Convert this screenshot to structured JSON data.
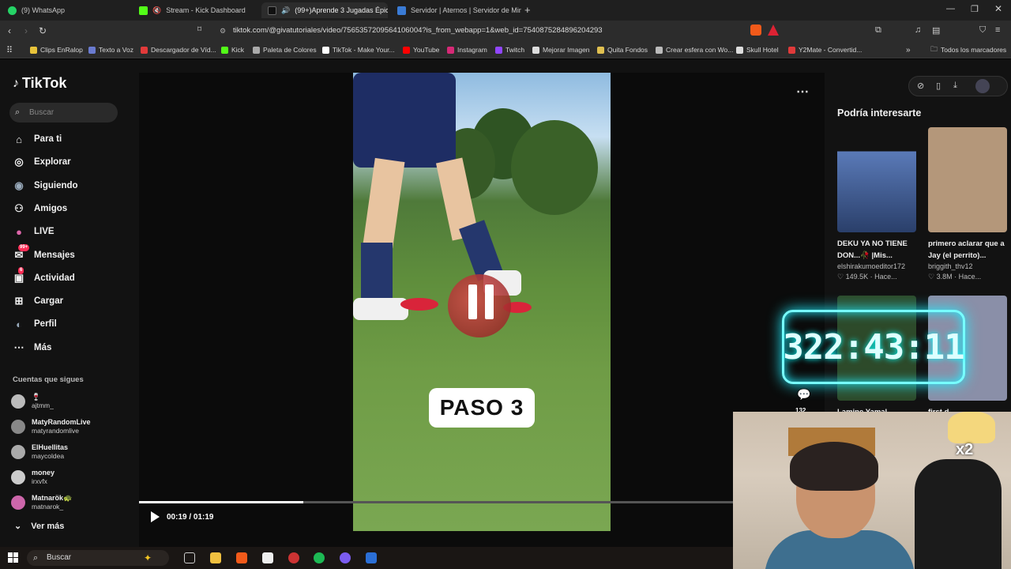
{
  "browser": {
    "tabs": [
      {
        "label": "(9) WhatsApp",
        "color": "#25d366"
      },
      {
        "label": "Stream - Kick Dashboard",
        "color": "#53fc18"
      },
      {
        "label": "(99+)Aprende 3 Jugadas Épic",
        "color": "#ffffff"
      },
      {
        "label": "Servidor | Aternos | Servidor de Mine",
        "color": "#3a7bd5"
      }
    ],
    "url": "tiktok.com/@givatutoriales/video/7565357209564106004?is_from_webapp=1&web_id=7540875284896204293",
    "bookmarks": [
      {
        "label": "Clips EnRalop",
        "color": "#e8c33a"
      },
      {
        "label": "Texto a Voz",
        "color": "#6a7bd0"
      },
      {
        "label": "Descargador de Víd...",
        "color": "#e23a3a"
      },
      {
        "label": "Kick",
        "color": "#53fc18"
      },
      {
        "label": "Paleta de Colores",
        "color": "#aaaaaa"
      },
      {
        "label": "TikTok - Make Your...",
        "color": "#ffffff"
      },
      {
        "label": "YouTube",
        "color": "#ff0000"
      },
      {
        "label": "Instagram",
        "color": "#d62976"
      },
      {
        "label": "Twitch",
        "color": "#9146ff"
      },
      {
        "label": "Mejorar Imagen",
        "color": "#dddddd"
      },
      {
        "label": "Quita Fondos",
        "color": "#e0c050"
      },
      {
        "label": "Crear esfera con Wo...",
        "color": "#bbbbbb"
      },
      {
        "label": "Skull Hotel",
        "color": "#dddddd"
      },
      {
        "label": "Y2Mate - Convertid...",
        "color": "#e03a3a"
      }
    ],
    "bookmarks_all": "Todos los marcadores"
  },
  "tiktok": {
    "logo": "TikTok",
    "search_placeholder": "Buscar",
    "nav": [
      {
        "label": "Para ti",
        "icon": "home-icon"
      },
      {
        "label": "Explorar",
        "icon": "compass-icon"
      },
      {
        "label": "Siguiendo",
        "icon": "following-icon"
      },
      {
        "label": "Amigos",
        "icon": "friends-icon"
      },
      {
        "label": "LIVE",
        "icon": "live-icon"
      },
      {
        "label": "Mensajes",
        "icon": "messages-icon",
        "badge": "99+"
      },
      {
        "label": "Actividad",
        "icon": "activity-icon",
        "badge": "6"
      },
      {
        "label": "Cargar",
        "icon": "upload-icon"
      },
      {
        "label": "Perfil",
        "icon": "profile-icon"
      },
      {
        "label": "Más",
        "icon": "more-icon"
      }
    ],
    "following_title": "Cuentas que sigues",
    "following": [
      {
        "name": "🍷",
        "handle": "ajtmm_"
      },
      {
        "name": "MatyRandomLive",
        "handle": "matyrandomlive"
      },
      {
        "name": "ElHuellitas",
        "handle": "maycoldea"
      },
      {
        "name": "money",
        "handle": "irxvfx"
      },
      {
        "name": "Matnarök🐢",
        "handle": "matnarok_"
      }
    ],
    "see_more": "Ver más"
  },
  "player": {
    "overlay_text": "PASO 3",
    "time": "00:19 / 01:19",
    "progress": 0.24,
    "author": "givatutoriales"
  },
  "recommended": {
    "title": "Podría interesarte",
    "cards": [
      {
        "title": "DEKU YA NO TIENE DON...🥀 |Mis...",
        "user": "elshirakumoeditor172",
        "stats": "♡ 149.5K · Hace...",
        "thumb": "#2a3f6a"
      },
      {
        "title": "primero aclarar que a Jay (el perrito)...",
        "user": "briggith_thv12",
        "stats": "♡ 3.8M · Hace...",
        "thumb": "#b4977a"
      },
      {
        "title": "Lamine Yamal",
        "user": "",
        "stats": "",
        "thumb": "#2d4a2a"
      },
      {
        "title": "first d...",
        "user": "",
        "stats": "",
        "thumb": "#8a8fa8"
      }
    ]
  },
  "overlay": {
    "timer": "322:43:11",
    "comments": "132",
    "multiplier": "x2"
  },
  "taskbar": {
    "search": "Buscar"
  }
}
